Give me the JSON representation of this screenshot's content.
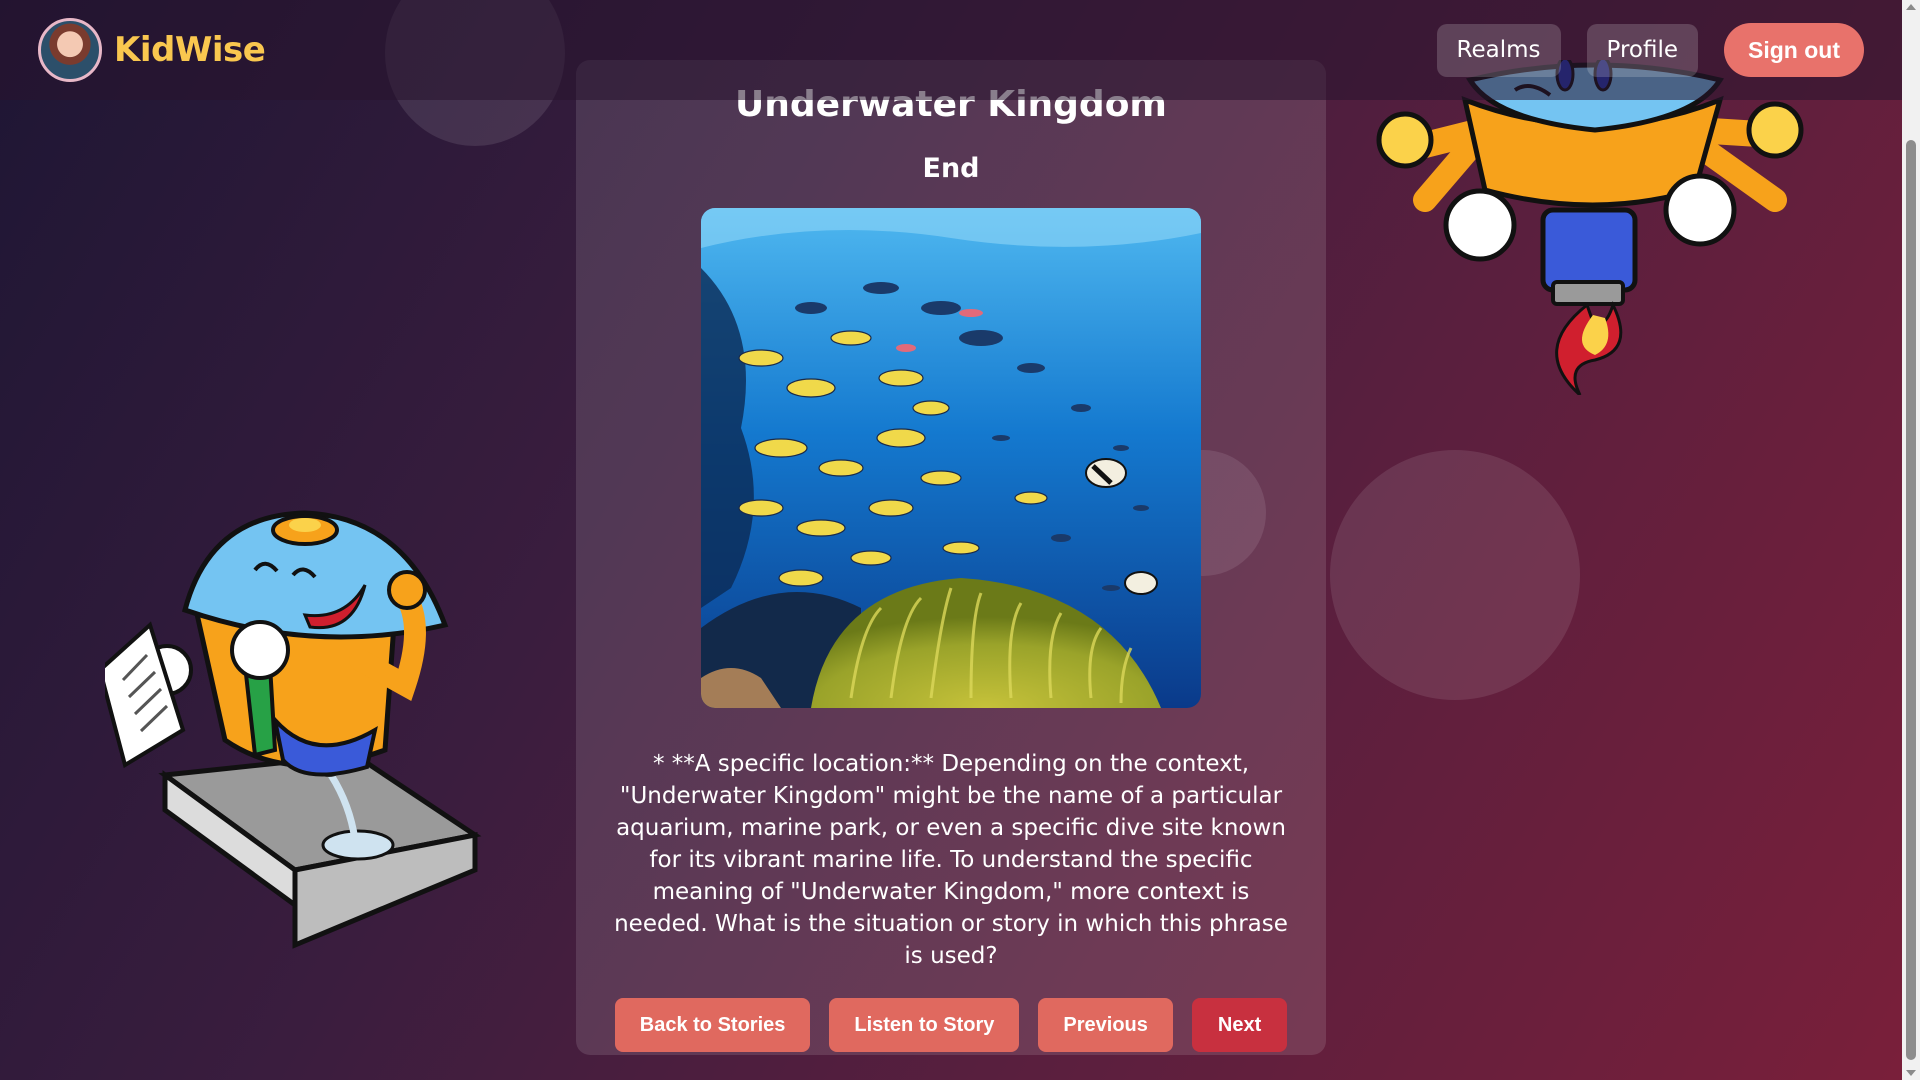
{
  "header": {
    "brand_name": "KidWise",
    "nav": {
      "realms": "Realms",
      "profile": "Profile",
      "sign_out": "Sign out"
    }
  },
  "story": {
    "title": "Underwater Kingdom",
    "page_label": "End",
    "image_subject": "coral reef with schools of tropical fish",
    "text": "* **A specific location:** Depending on the context, \"Underwater Kingdom\" might be the name of a particular aquarium, marine park, or even a specific dive site known for its vibrant marine life. To understand the specific meaning of \"Underwater Kingdom,\" more context is needed. What is the situation or story in which this phrase is used?"
  },
  "actions": {
    "back": "Back to Stories",
    "listen": "Listen to Story",
    "previous": "Previous",
    "next": "Next"
  },
  "colors": {
    "brand": "#f9c74f",
    "accent": "#e8726b",
    "primary": "#c8303f"
  },
  "icons": {
    "logo": "princess-avatar-icon",
    "mascot_left": "robot-reading-mascot",
    "mascot_right": "robot-jetpack-mascot"
  }
}
